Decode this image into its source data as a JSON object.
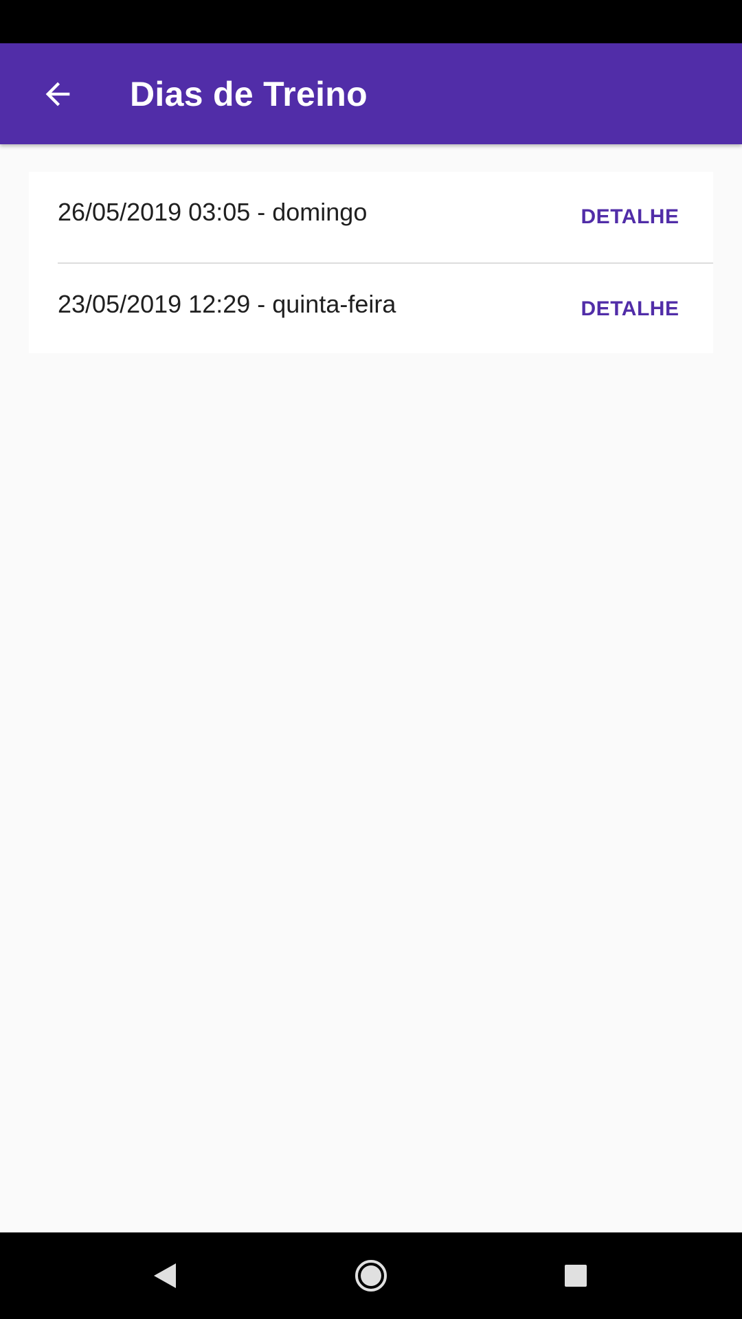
{
  "app_bar": {
    "title": "Dias de Treino",
    "back_icon": "arrow-left-icon",
    "color": "#512DA8"
  },
  "list": {
    "items": [
      {
        "label": "26/05/2019 03:05 - domingo",
        "action": "DETALHE"
      },
      {
        "label": "23/05/2019 12:29 - quinta-feira",
        "action": "DETALHE"
      }
    ]
  },
  "nav_bar": {
    "icons": [
      "nav-back-icon",
      "nav-home-icon",
      "nav-recents-icon"
    ]
  }
}
